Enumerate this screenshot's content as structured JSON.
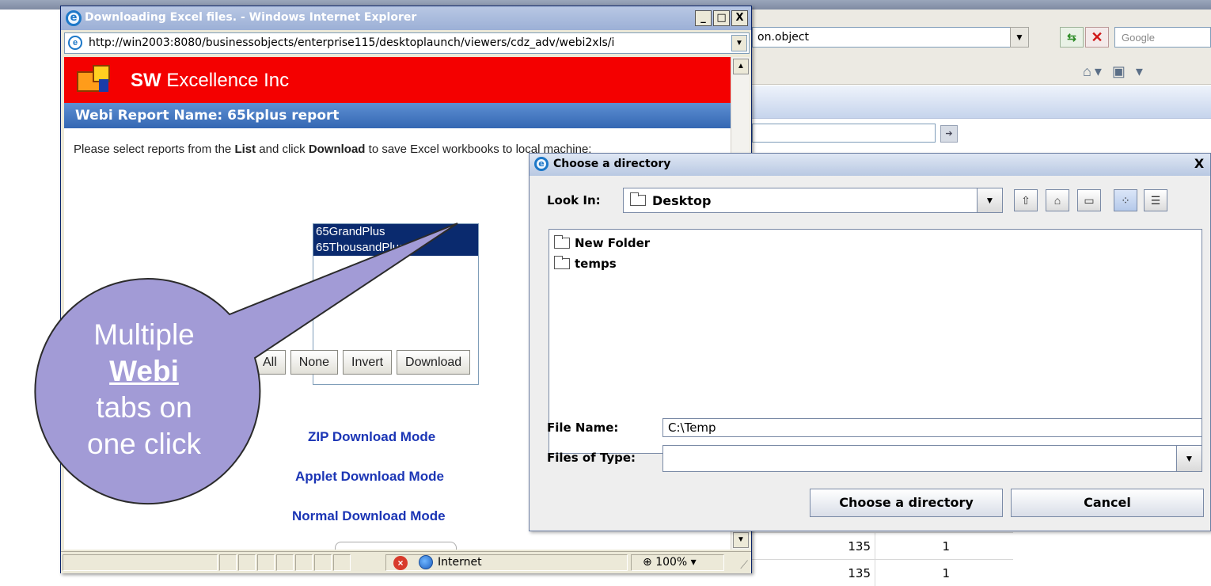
{
  "background_browser": {
    "address_fragment": "on.object",
    "search_placeholder": "Google",
    "table_rows": [
      {
        "c1": "135",
        "c2": "1"
      },
      {
        "c1": "135",
        "c2": "1"
      }
    ]
  },
  "ie_window": {
    "title": "Downloading Excel files. - Windows Internet Explorer",
    "url": "http://win2003:8080/businessobjects/enterprise115/desktoplaunch/viewers/cdz_adv/webi2xls/i",
    "company": "SW Excellence Inc",
    "company_prefix": "SW",
    "company_suffix": " Excellence Inc",
    "report_name": "Webi Report Name: 65kplus report",
    "instructions": {
      "part1": "Please select reports from the ",
      "list_word": "List",
      "part2": " and click ",
      "download_word": "Download",
      "part3": " to save Excel workbooks to local machine:"
    },
    "report_items": [
      "65GrandPlus",
      "65ThousandPlus"
    ],
    "buttons": {
      "all": "All",
      "none": "None",
      "invert": "Invert",
      "download": "Download"
    },
    "modes": {
      "zip": "ZIP Download Mode",
      "applet": "Applet Download Mode",
      "normal": "Normal Download Mode"
    },
    "status": {
      "zone": "Internet",
      "zoom": "100%"
    },
    "window_buttons": {
      "minimize": "_",
      "maximize": "□",
      "close": "X"
    }
  },
  "dialog": {
    "title": "Choose a directory",
    "look_in_label": "Look In:",
    "look_in_value": "Desktop",
    "folders": [
      "New Folder",
      "temps"
    ],
    "file_name_label": "File Name:",
    "file_name_value": "C:\\Temp",
    "files_of_type_label": "Files of Type:",
    "files_of_type_value": "",
    "choose_button": "Choose a directory",
    "cancel_button": "Cancel",
    "close": "X"
  },
  "callout": {
    "line1": "Multiple",
    "line2": "Webi",
    "line3": "tabs on",
    "line4": "one click",
    "fill_color": "#a29bd6",
    "stroke_color": "#2b2b2b"
  }
}
